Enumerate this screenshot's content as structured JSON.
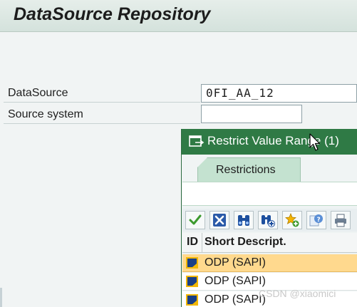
{
  "header": {
    "title": "DataSource Repository"
  },
  "form": {
    "datasource_label": "DataSource",
    "datasource_value": "0FI_AA_12",
    "source_system_label": "Source system",
    "source_system_value": ""
  },
  "dialog": {
    "title": "Restrict Value Range (1)",
    "tabs": [
      {
        "label": "Restrictions"
      }
    ],
    "toolbar_icons": [
      "checkmark-icon",
      "cancel-x-icon",
      "binoculars-icon",
      "binoculars-plus-icon",
      "star-add-icon",
      "info-help-icon",
      "print-icon"
    ],
    "columns": [
      "ID",
      "Short Descript."
    ],
    "rows": [
      {
        "desc": "ODP (SAPI)"
      },
      {
        "desc": "ODP (SAPI)"
      },
      {
        "desc": "ODP (SAPI)"
      }
    ]
  },
  "watermark": "CSDN @xiaomici",
  "colors": {
    "dialog_header": "#2f7a45",
    "tab_active": "#c4e2d0",
    "selected_row": "#ffd98e",
    "row_icon_blue": "#1a3f86",
    "row_icon_yellow": "#f2b705"
  }
}
